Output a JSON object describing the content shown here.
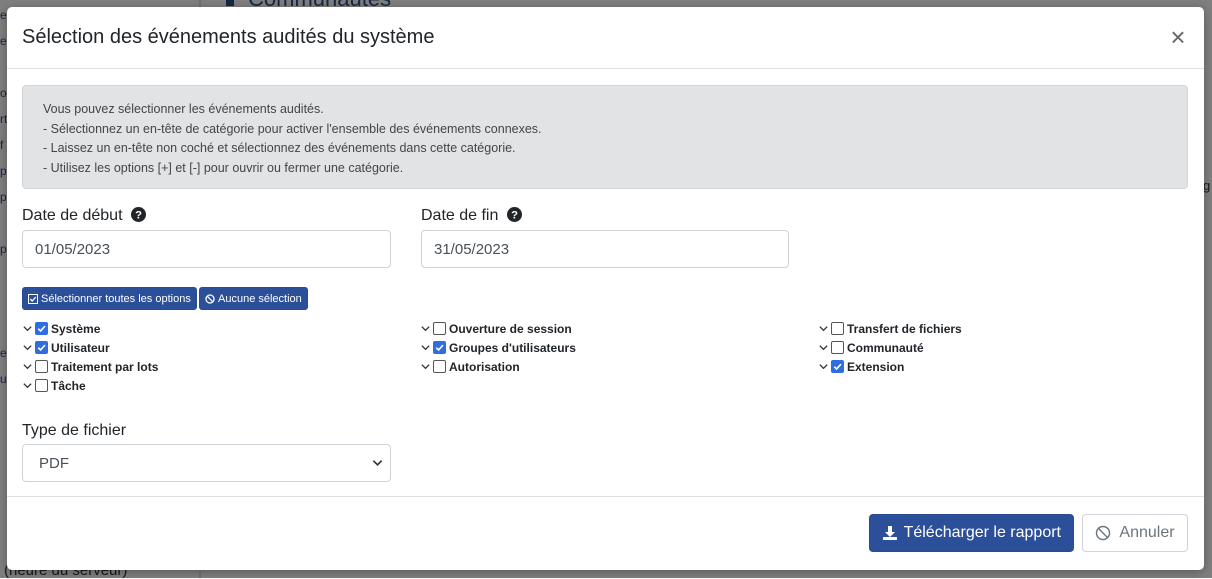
{
  "background": {
    "heading": "Communautés",
    "footer_text": "(heure du serveur)"
  },
  "modal": {
    "title": "Sélection des événements audités du système",
    "close_label": "×",
    "info_lines": [
      "Vous pouvez sélectionner les événements audités.",
      "- Sélectionnez un en-tête de catégorie pour activer l'ensemble des événements connexes.",
      "- Laissez un en-tête non coché et sélectionnez des événements dans cette catégorie.",
      "- Utilisez les options [+] et [-] pour ouvrir ou fermer une catégorie."
    ],
    "start_date": {
      "label": "Date de début",
      "value": "01/05/2023"
    },
    "end_date": {
      "label": "Date de fin",
      "value": "31/05/2023"
    },
    "select_all_label": "Sélectionner toutes les options",
    "select_none_label": "Aucune sélection",
    "categories": [
      {
        "label": "Système",
        "checked": true
      },
      {
        "label": "Utilisateur",
        "checked": true
      },
      {
        "label": "Traitement par lots",
        "checked": false
      },
      {
        "label": "Tâche",
        "checked": false
      },
      {
        "label": "Ouverture de session",
        "checked": false
      },
      {
        "label": "Groupes d'utilisateurs",
        "checked": true
      },
      {
        "label": "Autorisation",
        "checked": false
      },
      {
        "label": "Transfert de fichiers",
        "checked": false
      },
      {
        "label": "Communauté",
        "checked": false
      },
      {
        "label": "Extension",
        "checked": true
      }
    ],
    "file_type": {
      "label": "Type de fichier",
      "value": "PDF"
    },
    "download_label": "Télécharger le rapport",
    "cancel_label": "Annuler"
  },
  "colors": {
    "primary": "#2c4f9a",
    "checkbox_checked": "#2f6de1",
    "info_bg": "#e2e3e5"
  }
}
